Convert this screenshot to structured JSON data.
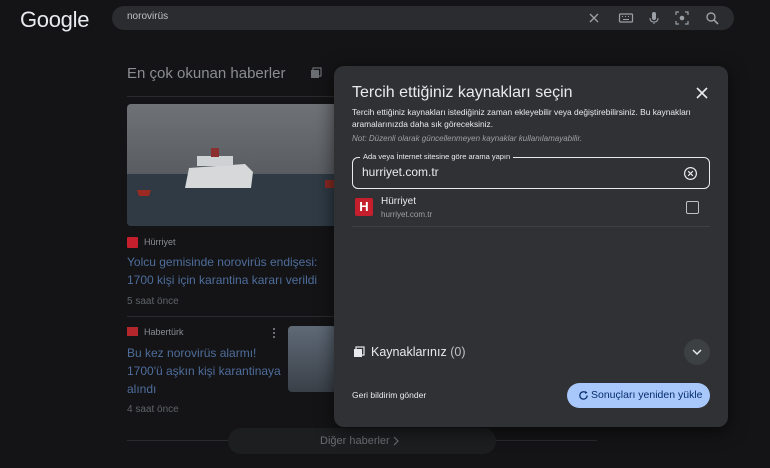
{
  "header": {
    "logo_text": "Google",
    "search_query": "norovirüs",
    "icons": [
      "clear-icon",
      "keyboard-icon",
      "mic-icon",
      "lens-icon",
      "search-icon"
    ]
  },
  "background": {
    "section_title": "En çok okunan haberler",
    "news": [
      {
        "source": "Hürriyet",
        "headline": "Yolcu gemisinde norovirüs endişesi: 1700 kişi için karantina kararı verildi",
        "time": "5 saat önce"
      },
      {
        "source": "Habertürk",
        "headline": "Bu kez norovirüs alarmı! 1700'ü aşkın kişi karantinaya alındı",
        "time": "4 saat önce"
      }
    ],
    "more_button": "Diğer haberler"
  },
  "dialog": {
    "title": "Tercih ettiğiniz kaynakları seçin",
    "description": "Tercih ettiğiniz kaynakları istediğiniz zaman ekleyebilir veya değiştirebilirsiniz. Bu kaynakları aramalarınızda daha sık göreceksiniz.",
    "note": "Not: Düzenli olarak güncellenmeyen kaynaklar kullanılamayabilir.",
    "search_label": "Ada veya İnternet sitesine göre arama yapın",
    "search_value": "hurriyet.com.tr",
    "result": {
      "logo_letter": "H",
      "name": "Hürriyet",
      "url": "hurriyet.com.tr",
      "checked": false
    },
    "sources_label": "Kaynaklarınız",
    "sources_count": "(0)",
    "feedback": "Geri bildirim gönder",
    "reload_button": "Sonuçları yeniden yükle"
  },
  "colors": {
    "background": "#141416",
    "dialog": "#303134",
    "accent_button": "#a8c7fa",
    "brand_hurriyet": "#c51f2d"
  }
}
